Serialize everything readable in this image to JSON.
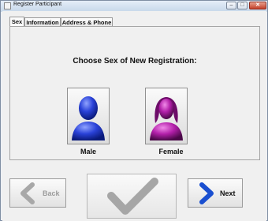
{
  "window": {
    "title": "Register Participant"
  },
  "tabs": [
    {
      "label": "Sex"
    },
    {
      "label": "Information"
    },
    {
      "label": "Address & Phone"
    }
  ],
  "main": {
    "heading": "Choose Sex of New Registration:",
    "male_label": "Male",
    "female_label": "Female"
  },
  "nav": {
    "back_label": "Back",
    "next_label": "Next"
  },
  "icons": {
    "male": "male-user-icon",
    "female": "female-user-icon",
    "back": "back-arrow-icon",
    "next": "next-arrow-icon",
    "confirm": "checkmark-icon"
  },
  "colors": {
    "male": "#1f3fd6",
    "female": "#b020a8",
    "next_arrow": "#1a4fd0",
    "disabled": "#a8a8a8"
  }
}
